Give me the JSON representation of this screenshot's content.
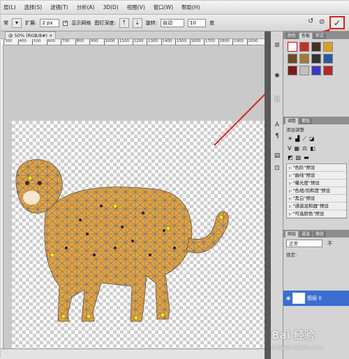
{
  "menu": [
    "层(L)",
    "选择(S)",
    "滤镜(T)",
    "分析(A)",
    "3D(D)",
    "视图(V)",
    "窗口(W)",
    "帮助(H)"
  ],
  "options": {
    "mode_value": "常",
    "expand_label": "扩展:",
    "expand_value": "2 px",
    "show_mesh_label": "显示网格",
    "depth_label": "图钉深度:",
    "rotate_label": "旋转:",
    "rotate_value": "自动",
    "angle_value": "10",
    "degree_label": "度"
  },
  "document": {
    "tab_label": "@ 50% (RGB/8#)"
  },
  "ruler_ticks": [
    "300",
    "400",
    "500",
    "600",
    "700",
    "800",
    "900",
    "1000",
    "1100",
    "1200",
    "1300",
    "1400",
    "1500",
    "1600",
    "1700",
    "1800",
    "1900",
    "2000"
  ],
  "panels": {
    "tabs_top": [
      "颜色",
      "色板",
      "样式"
    ],
    "tabs_adjust": [
      "调整",
      "蒙版"
    ],
    "adjust_title": "添加调整",
    "presets": [
      "\"色阶\"预设",
      "\"曲线\"预设",
      "\"曝光度\"预设",
      "\"色相/饱和度\"预设",
      "\"黑白\"预设",
      "\"通道混和器\"预设",
      "\"可选颜色\"预设"
    ],
    "tabs_layers": [
      "图层",
      "通道",
      "路径"
    ],
    "blend_mode": "正常",
    "opacity_label": "不",
    "lock_label": "锁定:",
    "layer_name": "图层 0"
  },
  "watermark": {
    "brand": "Bai 经验",
    "url": "jingyan.baidu.com"
  },
  "colors": {
    "accent_red": "#e02020",
    "layer_selected": "#3a6fd1",
    "cheetah": "#e8a23a"
  },
  "icons": [
    "undo-icon",
    "cancel-icon",
    "commit-check-icon",
    "eye-icon"
  ]
}
